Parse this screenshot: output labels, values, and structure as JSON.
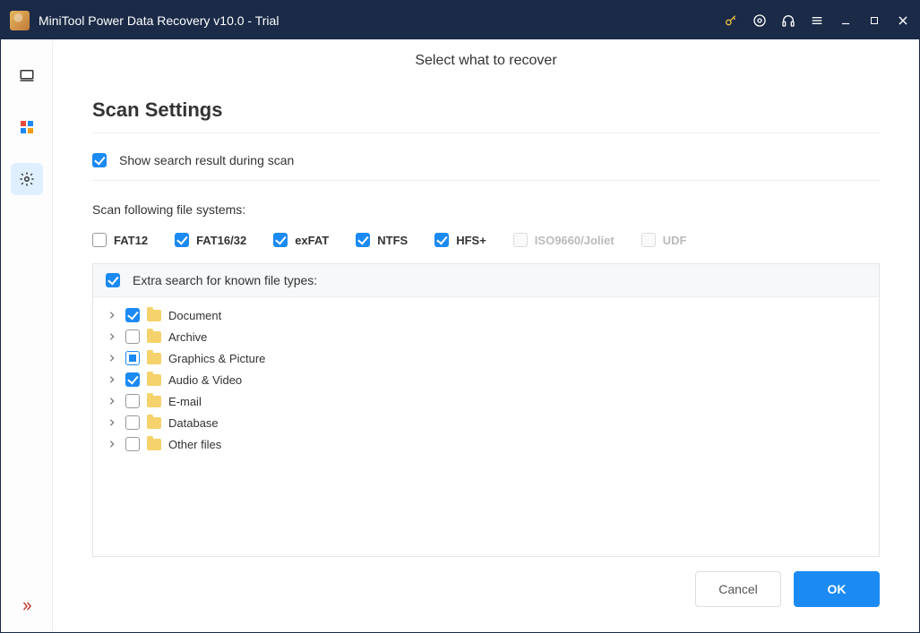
{
  "window": {
    "title": "MiniTool Power Data Recovery v10.0 - Trial"
  },
  "header": {
    "title": "Select what to recover"
  },
  "panel": {
    "title": "Scan Settings",
    "show_during_scan": {
      "label": "Show search result during scan",
      "checked": true
    },
    "fs_label": "Scan following file systems:",
    "filesystems": [
      {
        "label": "FAT12",
        "checked": false,
        "disabled": false
      },
      {
        "label": "FAT16/32",
        "checked": true,
        "disabled": false
      },
      {
        "label": "exFAT",
        "checked": true,
        "disabled": false
      },
      {
        "label": "NTFS",
        "checked": true,
        "disabled": false
      },
      {
        "label": "HFS+",
        "checked": true,
        "disabled": false
      },
      {
        "label": "ISO9660/Joliet",
        "checked": false,
        "disabled": true
      },
      {
        "label": "UDF",
        "checked": false,
        "disabled": true
      }
    ],
    "extra_search": {
      "label": "Extra search for known file types:",
      "checked": true
    },
    "file_types": [
      {
        "label": "Document",
        "state": "checked"
      },
      {
        "label": "Archive",
        "state": "unchecked"
      },
      {
        "label": "Graphics & Picture",
        "state": "partial"
      },
      {
        "label": "Audio & Video",
        "state": "checked"
      },
      {
        "label": "E-mail",
        "state": "unchecked"
      },
      {
        "label": "Database",
        "state": "unchecked"
      },
      {
        "label": "Other files",
        "state": "unchecked"
      }
    ]
  },
  "buttons": {
    "cancel": "Cancel",
    "ok": "OK"
  }
}
